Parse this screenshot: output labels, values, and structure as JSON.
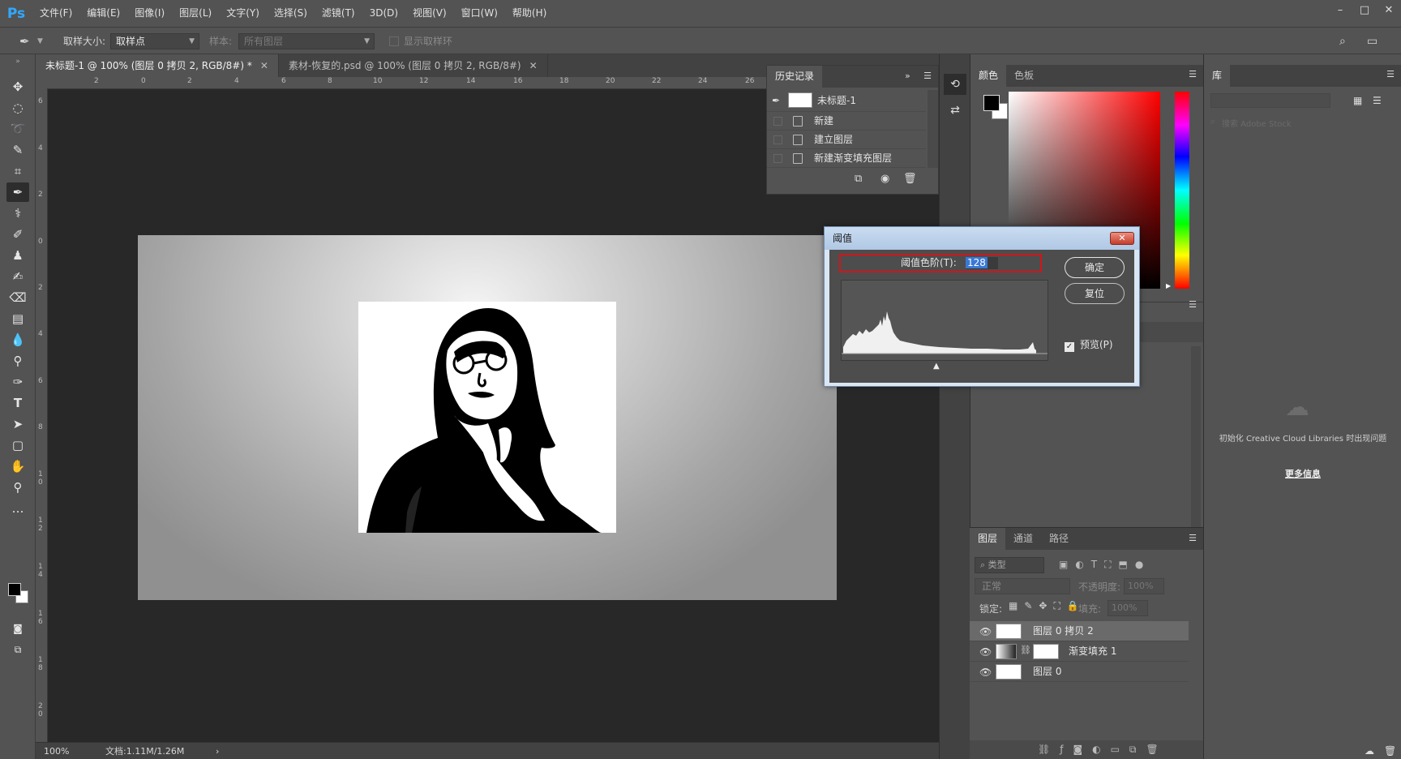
{
  "app": {
    "logo": "Ps"
  },
  "menu": [
    "文件(F)",
    "编辑(E)",
    "图像(I)",
    "图层(L)",
    "文字(Y)",
    "选择(S)",
    "滤镜(T)",
    "3D(D)",
    "视图(V)",
    "窗口(W)",
    "帮助(H)"
  ],
  "options": {
    "sample_size_label": "取样大小:",
    "sample_size_value": "取样点",
    "sample_label": "样本:",
    "sample_value": "所有图层",
    "show_ring_label": "显示取样环"
  },
  "doc_tabs": [
    {
      "label": "未标题-1 @ 100% (图层 0 拷贝 2, RGB/8#) *",
      "active": true
    },
    {
      "label": "素材-恢复的.psd @ 100% (图层 0 拷贝 2, RGB/8#)",
      "active": false
    }
  ],
  "ruler": {
    "top": [
      "2",
      "0",
      "2",
      "4",
      "6",
      "8",
      "10",
      "12",
      "14",
      "16",
      "18",
      "20",
      "22",
      "24",
      "26"
    ],
    "left": [
      "6",
      "4",
      "2",
      "0",
      "2",
      "4",
      "6",
      "8",
      "1 0",
      "1 2",
      "1 4",
      "1 6",
      "1 8",
      "2 0"
    ]
  },
  "status": {
    "zoom": "100%",
    "doc_size": "文档:1.11M/1.26M"
  },
  "history": {
    "tab": "历史记录",
    "snapshot": "未标题-1",
    "items": [
      "新建",
      "建立图层",
      "新建渐变填充图层"
    ]
  },
  "color_panel": {
    "tabs": [
      "颜色",
      "色板"
    ],
    "foreground": "#000000",
    "background": "#ffffff"
  },
  "library": {
    "tab": "库",
    "search_placeholder": "搜索 Adobe Stock",
    "message": "初始化 Creative Cloud Libraries 时出现问题",
    "more_info": "更多信息"
  },
  "layers": {
    "tabs": [
      "图层",
      "通道",
      "路径"
    ],
    "filter_label": "类型",
    "blend_mode": "正常",
    "opacity_label": "不透明度:",
    "opacity_value": "100%",
    "lock_label": "锁定:",
    "fill_label": "填充:",
    "fill_value": "100%",
    "items": [
      {
        "name": "图层 0 拷贝 2",
        "selected": true
      },
      {
        "name": "渐变填充 1",
        "selected": false
      },
      {
        "name": "图层 0",
        "selected": false
      }
    ]
  },
  "dialog": {
    "title": "阈值",
    "threshold_label": "阈值色阶(T):",
    "threshold_value": "128",
    "ok": "确定",
    "reset": "复位",
    "preview_label": "预览(P)",
    "preview_checked": true
  }
}
